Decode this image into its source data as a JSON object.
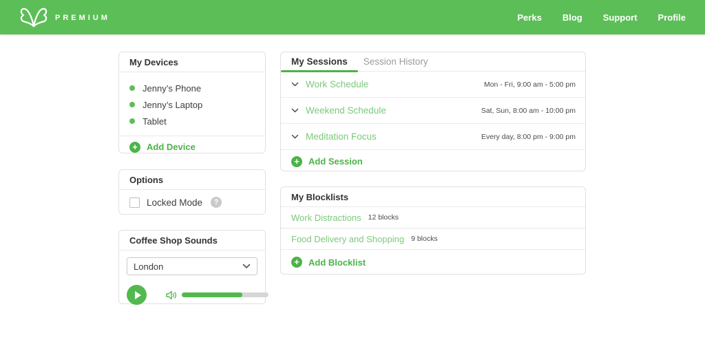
{
  "header": {
    "brand": "PREMIUM",
    "nav": [
      {
        "label": "Perks"
      },
      {
        "label": "Blog"
      },
      {
        "label": "Support"
      },
      {
        "label": "Profile"
      }
    ]
  },
  "devices": {
    "title": "My Devices",
    "items": [
      {
        "name": "Jenny’s Phone"
      },
      {
        "name": "Jenny’s Laptop"
      },
      {
        "name": "Tablet"
      }
    ],
    "add_label": "Add Device"
  },
  "options": {
    "title": "Options",
    "locked_mode_label": "Locked Mode",
    "locked_mode_checked": false
  },
  "sounds": {
    "title": "Coffee Shop Sounds",
    "selected_city": "London",
    "volume_percent": 70,
    "state": "playing-paused"
  },
  "sessions": {
    "tabs": [
      {
        "label": "My Sessions",
        "active": true
      },
      {
        "label": "Session History",
        "active": false
      }
    ],
    "rows": [
      {
        "name": "Work Schedule",
        "schedule": "Mon - Fri, 9:00 am - 5:00 pm"
      },
      {
        "name": "Weekend Schedule",
        "schedule": "Sat, Sun, 8:00 am - 10:00 pm"
      },
      {
        "name": "Meditation Focus",
        "schedule": "Every day, 8:00 pm - 9:00 pm"
      }
    ],
    "add_label": "Add Session"
  },
  "blocklists": {
    "title": "My Blocklists",
    "rows": [
      {
        "name": "Work Distractions",
        "count": "12 blocks"
      },
      {
        "name": "Food Delivery and Shopping",
        "count": "9 blocks"
      }
    ],
    "add_label": "Add Blocklist"
  },
  "colors": {
    "header_green": "#5cbe57",
    "link_green": "#7cc97a",
    "action_green": "#4cb348",
    "tab_underline_green": "#4cb249",
    "track_gray": "#d6d6d6"
  }
}
